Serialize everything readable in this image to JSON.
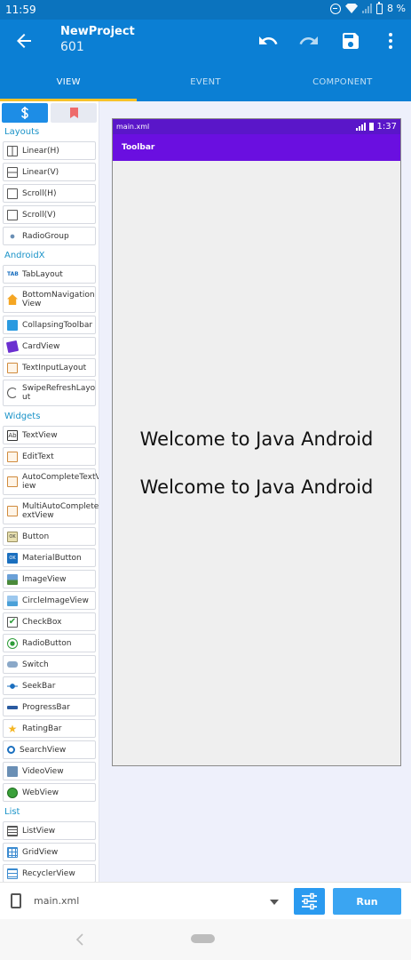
{
  "status_bar": {
    "time": "11:59",
    "battery": "8 %"
  },
  "app_bar": {
    "project_name": "NewProject",
    "project_id": "601"
  },
  "tabs": [
    {
      "label": "VIEW",
      "active": true
    },
    {
      "label": "EVENT",
      "active": false
    },
    {
      "label": "COMPONENT",
      "active": false
    }
  ],
  "palette": {
    "sections": {
      "layouts": "Layouts",
      "androidx": "AndroidX",
      "widgets": "Widgets",
      "list": "List"
    },
    "layouts": [
      "Linear(H)",
      "Linear(V)",
      "Scroll(H)",
      "Scroll(V)",
      "RadioGroup"
    ],
    "androidx": [
      "TabLayout",
      "BottomNavigation\nView",
      "CollapsingToolbar",
      "CardView",
      "TextInputLayout",
      "SwipeRefreshLayo\nut"
    ],
    "widgets": [
      "TextView",
      "EditText",
      "AutoCompleteTextV\niew",
      "MultiAutoCompleteT\nextView",
      "Button",
      "MaterialButton",
      "ImageView",
      "CircleImageView",
      "CheckBox",
      "RadioButton",
      "Switch",
      "SeekBar",
      "ProgressBar",
      "RatingBar",
      "SearchView",
      "VideoView",
      "WebView"
    ],
    "list": [
      "ListView",
      "GridView",
      "RecyclerView"
    ]
  },
  "preview": {
    "file_label": "main.xml",
    "clock": "1:37",
    "toolbar_title": "Toolbar",
    "text_1": "Welcome to Java Android",
    "text_2": "Welcome to Java Android",
    "colors": {
      "status": "#5a16c9",
      "toolbar": "#6a0fe0"
    }
  },
  "bottom_bar": {
    "file_name": "main.xml",
    "run_label": "Run"
  },
  "colors": {
    "primary": "#0b7fd4",
    "accent": "#f7c22a",
    "section": "#1a93c8"
  }
}
